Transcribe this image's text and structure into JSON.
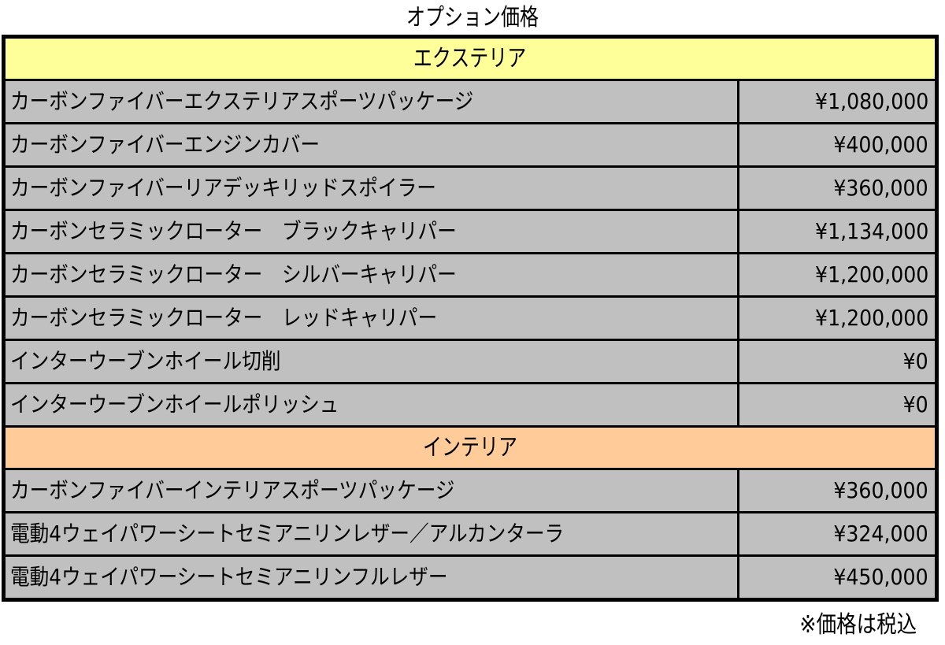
{
  "title": "オプション価格",
  "sections": [
    {
      "label": "エクステリア",
      "color": "#ffff99",
      "items": [
        {
          "name": "カーボンファイバーエクステリアスポーツパッケージ",
          "price": "¥1,080,000"
        },
        {
          "name": "カーボンファイバーエンジンカバー",
          "price": "¥400,000"
        },
        {
          "name": "カーボンファイバーリアデッキリッドスポイラー",
          "price": "¥360,000"
        },
        {
          "name": "カーボンセラミックローター　ブラックキャリパー",
          "price": "¥1,134,000"
        },
        {
          "name": "カーボンセラミックローター　シルバーキャリパー",
          "price": "¥1,200,000"
        },
        {
          "name": "カーボンセラミックローター　レッドキャリパー",
          "price": "¥1,200,000"
        },
        {
          "name": "インターウーブンホイール切削",
          "price": "¥0"
        },
        {
          "name": "インターウーブンホイールポリッシュ",
          "price": "¥0"
        }
      ]
    },
    {
      "label": "インテリア",
      "color": "#ffcc99",
      "items": [
        {
          "name": "カーボンファイバーインテリアスポーツパッケージ",
          "price": "¥360,000"
        },
        {
          "name": "電動4ウェイパワーシートセミアニリンレザー／アルカンターラ",
          "price": "¥324,000"
        },
        {
          "name": "電動4ウェイパワーシートセミアニリンフルレザー",
          "price": "¥450,000"
        }
      ]
    }
  ],
  "note": "※価格は税込"
}
